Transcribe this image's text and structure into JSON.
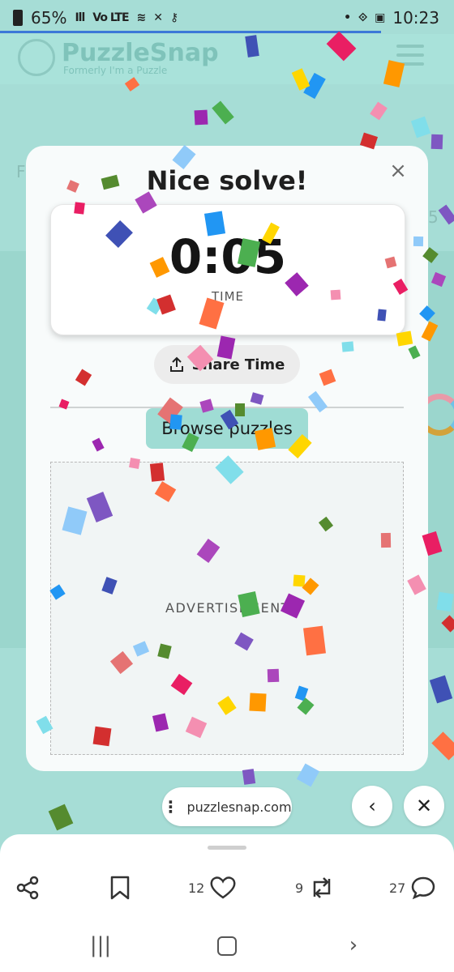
{
  "status_bar": {
    "battery": "65%",
    "time": "10:23"
  },
  "site": {
    "logo_name": "PuzzleSnap",
    "logo_tagline": "Formerly I'm a Puzzle",
    "bg_left_char": "F",
    "bg_right_char": "5"
  },
  "modal": {
    "title": "Nice solve!",
    "close_glyph": "×",
    "time_value": "0:05",
    "time_label": "TIME",
    "share_label": "Share Time",
    "browse_label": "Browse puzzles",
    "ad_label": "ADVERTISEMENT"
  },
  "browser": {
    "url": "puzzlesnap.com",
    "back_glyph": "‹",
    "close_glyph": "✕"
  },
  "actions": {
    "likes": "12",
    "reposts": "9",
    "comments": "27"
  },
  "colors": {
    "accent": "#9fdcd4",
    "background": "#a6ddd6"
  },
  "icons": [
    "share-icon",
    "bookmark-icon",
    "heart-icon",
    "repost-icon",
    "comment-icon",
    "recents-icon",
    "home-icon",
    "back-icon"
  ]
}
